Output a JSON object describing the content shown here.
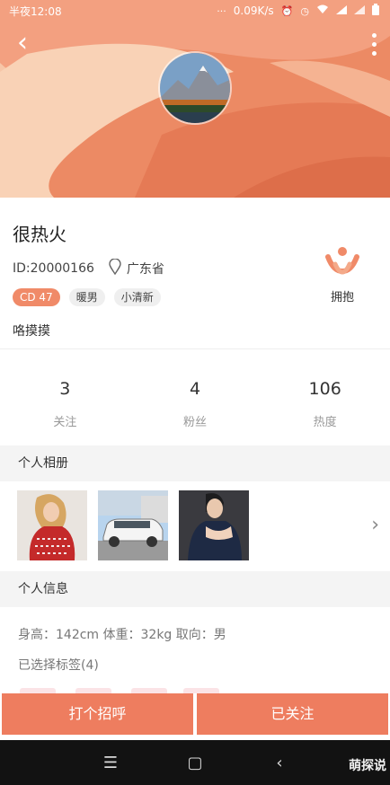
{
  "status_bar": {
    "time": "半夜12:08",
    "speed": "0.09K/s",
    "icons": [
      "alarm-icon",
      "clock-icon",
      "wifi-icon",
      "signal-icon",
      "signal-icon",
      "battery-icon"
    ]
  },
  "header": {
    "back_icon": "chevron-left-icon",
    "more_icon": "more-vertical-icon",
    "accent": "#f08a68"
  },
  "profile": {
    "nickname": "很热火",
    "id": "ID:20000166",
    "location": "广东省",
    "tags": [
      "CD 47",
      "暖男",
      "小清新"
    ],
    "bio": "咯摸摸",
    "hug_label": "拥抱"
  },
  "stats": [
    {
      "value": "3",
      "label": "关注"
    },
    {
      "value": "4",
      "label": "粉丝"
    },
    {
      "value": "106",
      "label": "热度"
    }
  ],
  "album": {
    "title": "个人相册"
  },
  "info": {
    "title": "个人信息",
    "detail": "身高：142cm  体重：32kg  取向：男",
    "tags_label": "已选择标签(4)"
  },
  "actions": {
    "greet": "打个招呼",
    "followed": "已关注"
  },
  "navbar": {
    "menu": "☰",
    "home": "▢",
    "back": "‹"
  },
  "watermark": "萌探说"
}
